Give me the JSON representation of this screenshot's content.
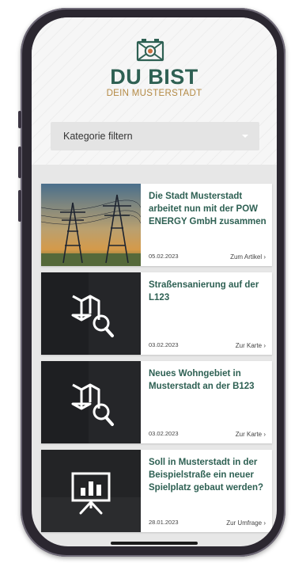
{
  "brand": {
    "title": "DU BIST",
    "subtitle": "DEIN MUSTERSTADT",
    "icon": "camera-logo-icon",
    "primary_color": "#2e6053",
    "accent_color": "#b48a45"
  },
  "filter": {
    "label": "Kategorie filtern",
    "icon": "chevron-down-icon"
  },
  "articles": [
    {
      "title": "Die Stadt Musterstadt arbeitet nun mit der POW ENERGY GmbH zusammen",
      "date": "05.02.2023",
      "link": "Zum Artikel ›",
      "image": "power-lines-photo"
    },
    {
      "title": "Straßensanierung auf der L123",
      "date": "03.02.2023",
      "link": "Zur Karte ›",
      "image": "map-search-icon"
    },
    {
      "title": "Neues Wohngebiet in Musterstadt an der B123",
      "date": "03.02.2023",
      "link": "Zur Karte ›",
      "image": "map-search-icon"
    },
    {
      "title": "Soll in Musterstadt in der Beispielstraße ein neuer Spielplatz gebaut werden?",
      "date": "28.01.2023",
      "link": "Zur Umfrage ›",
      "image": "presentation-chart-icon"
    }
  ]
}
